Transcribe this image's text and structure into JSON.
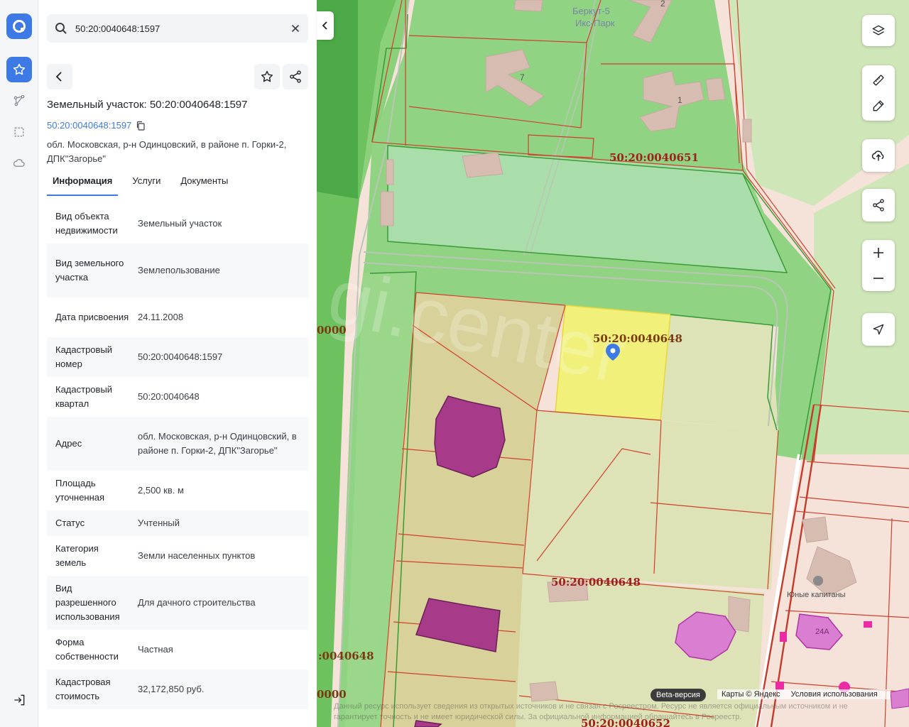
{
  "search": {
    "value": "50:20:0040648:1597"
  },
  "header": {
    "title": "Земельный участок: 50:20:0040648:1597",
    "cad_number": "50:20:0040648:1597",
    "address": "обл. Московская, р-н Одинцовский, в районе п. Горки-2, ДПК\"Загорье\""
  },
  "tabs": [
    "Информация",
    "Услуги",
    "Документы"
  ],
  "info": [
    {
      "k": "Вид объекта недвижимости",
      "v": "Земельный участок"
    },
    {
      "k": "Вид земельного участка",
      "v": "Землепользование"
    },
    {
      "k": "Дата присвоения",
      "v": "24.11.2008"
    },
    {
      "k": "Кадастровый номер",
      "v": "50:20:0040648:1597"
    },
    {
      "k": "Кадастровый квартал",
      "v": "50:20:0040648"
    },
    {
      "k": "Адрес",
      "v": "обл. Московская, р-н Одинцовский, в районе п. Горки-2, ДПК\"Загорье\""
    },
    {
      "k": "Площадь уточненная",
      "v": "2,500 кв. м"
    },
    {
      "k": "Статус",
      "v": "Учтенный"
    },
    {
      "k": "Категория земель",
      "v": "Земли населенных пунктов"
    },
    {
      "k": "Вид разрешенного использования",
      "v": "Для дачного строительства"
    },
    {
      "k": "Форма собственности",
      "v": "Частная"
    },
    {
      "k": "Кадастровая стоимость",
      "v": "32,172,850 руб."
    }
  ],
  "map": {
    "labels": {
      "q0651": "50:20:0040651",
      "q0648a": "50:20:0040648",
      "q0648b": "50:20:0040648",
      "q0648left": ":0040648",
      "zero1": "0000",
      "zero2": "0000",
      "q06x": "50:20:0040652",
      "berkut": "Беркут-5",
      "iks": "Икс-Парк",
      "h2": "2",
      "h7": "7",
      "h1": "1",
      "junye": "Юные капитаны",
      "h24a": "24А",
      "watermark": "gi.center"
    },
    "beta": "Beta-версия",
    "attrib_maps": "Карты © Яндекс",
    "attrib_terms": "Условия использования",
    "disclaimer": "Данный ресурс использует сведения из открытых источников и не связан с Росреестром. Ресурс не является официальным источником и не гарантирует точность и не имеет юридической силы. За официальной информацией обращайтесь в Росреестр."
  },
  "colors": {
    "accent": "#3e7ae6",
    "selected_parcel": "#f0f07a",
    "green": "#7fcf6e",
    "border_red": "#d0402c"
  }
}
